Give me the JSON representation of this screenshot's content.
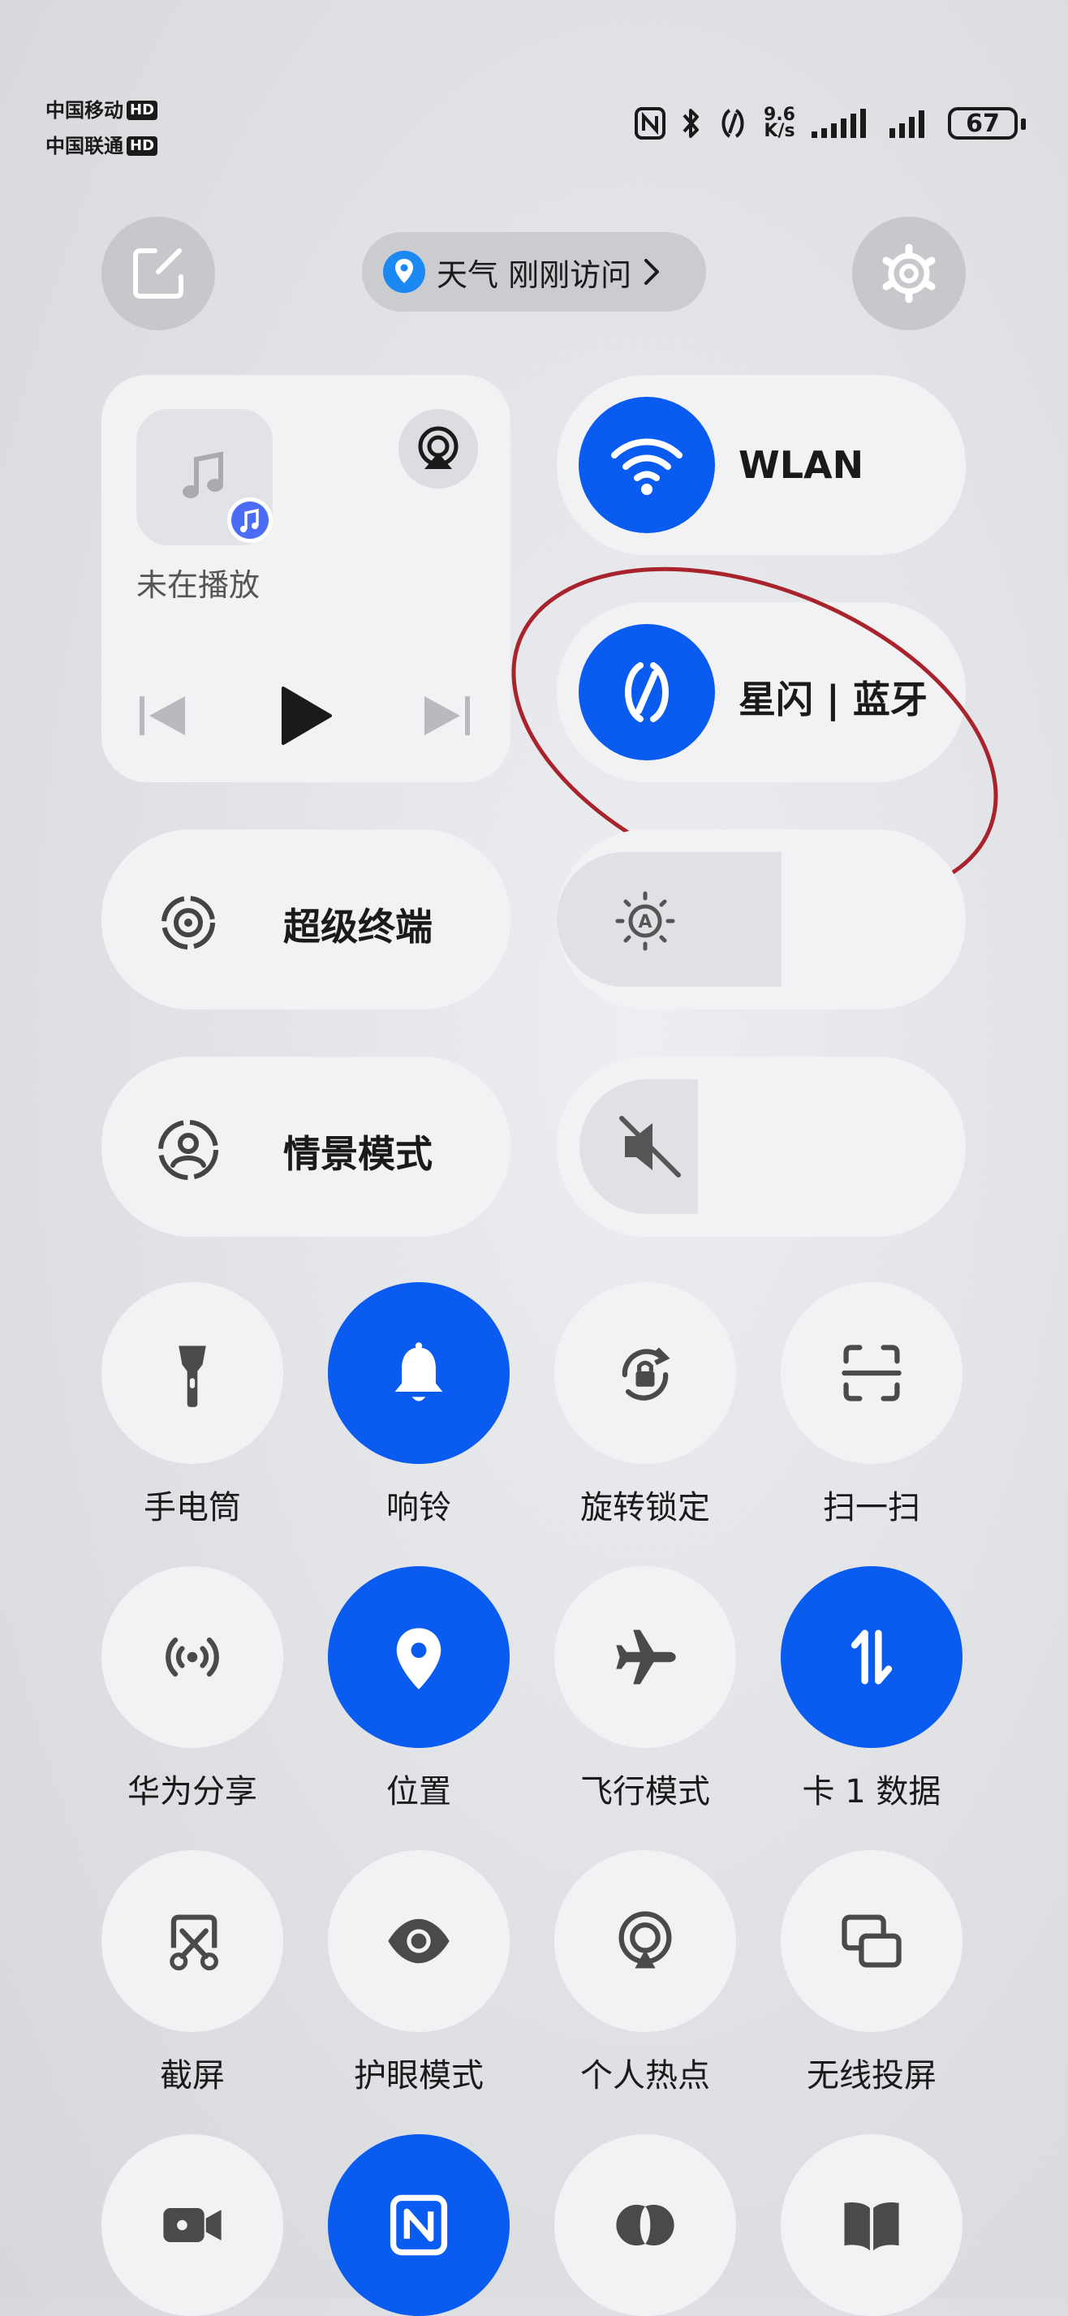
{
  "status_bar": {
    "carrier1": "中国移动",
    "carrier2": "中国联通",
    "hd": "HD",
    "speed_value": "9.6",
    "speed_unit": "K/s",
    "battery": "67"
  },
  "header": {
    "weather_label": "天气 刚刚访问"
  },
  "media": {
    "status": "未在播放"
  },
  "toggles": {
    "wlan": "WLAN",
    "bluetooth": "星闪 | 蓝牙",
    "super_device": "超级终端",
    "scene_mode": "情景模式"
  },
  "sliders": {
    "brightness_level": 0.55,
    "volume_level": 0.29
  },
  "tiles": [
    {
      "label": "手电筒",
      "icon": "flashlight-icon",
      "on": false
    },
    {
      "label": "响铃",
      "icon": "bell-icon",
      "on": true
    },
    {
      "label": "旋转锁定",
      "icon": "rotation-lock-icon",
      "on": false
    },
    {
      "label": "扫一扫",
      "icon": "scan-icon",
      "on": false
    },
    {
      "label": "华为分享",
      "icon": "share-icon",
      "on": false
    },
    {
      "label": "位置",
      "icon": "location-icon",
      "on": true
    },
    {
      "label": "飞行模式",
      "icon": "airplane-icon",
      "on": false
    },
    {
      "label": "卡 1 数据",
      "icon": "mobile-data-icon",
      "on": true
    },
    {
      "label": "截屏",
      "icon": "screenshot-icon",
      "on": false
    },
    {
      "label": "护眼模式",
      "icon": "eye-icon",
      "on": false
    },
    {
      "label": "个人热点",
      "icon": "hotspot-icon",
      "on": false
    },
    {
      "label": "无线投屏",
      "icon": "cast-icon",
      "on": false
    },
    {
      "icon": "video-icon",
      "on": false
    },
    {
      "icon": "nfc-icon",
      "on": true
    },
    {
      "icon": "dual-circle-icon",
      "on": false
    },
    {
      "icon": "book-icon",
      "on": false
    }
  ],
  "colors": {
    "accent": "#0a5bf0",
    "annotation": "#a8232b"
  }
}
